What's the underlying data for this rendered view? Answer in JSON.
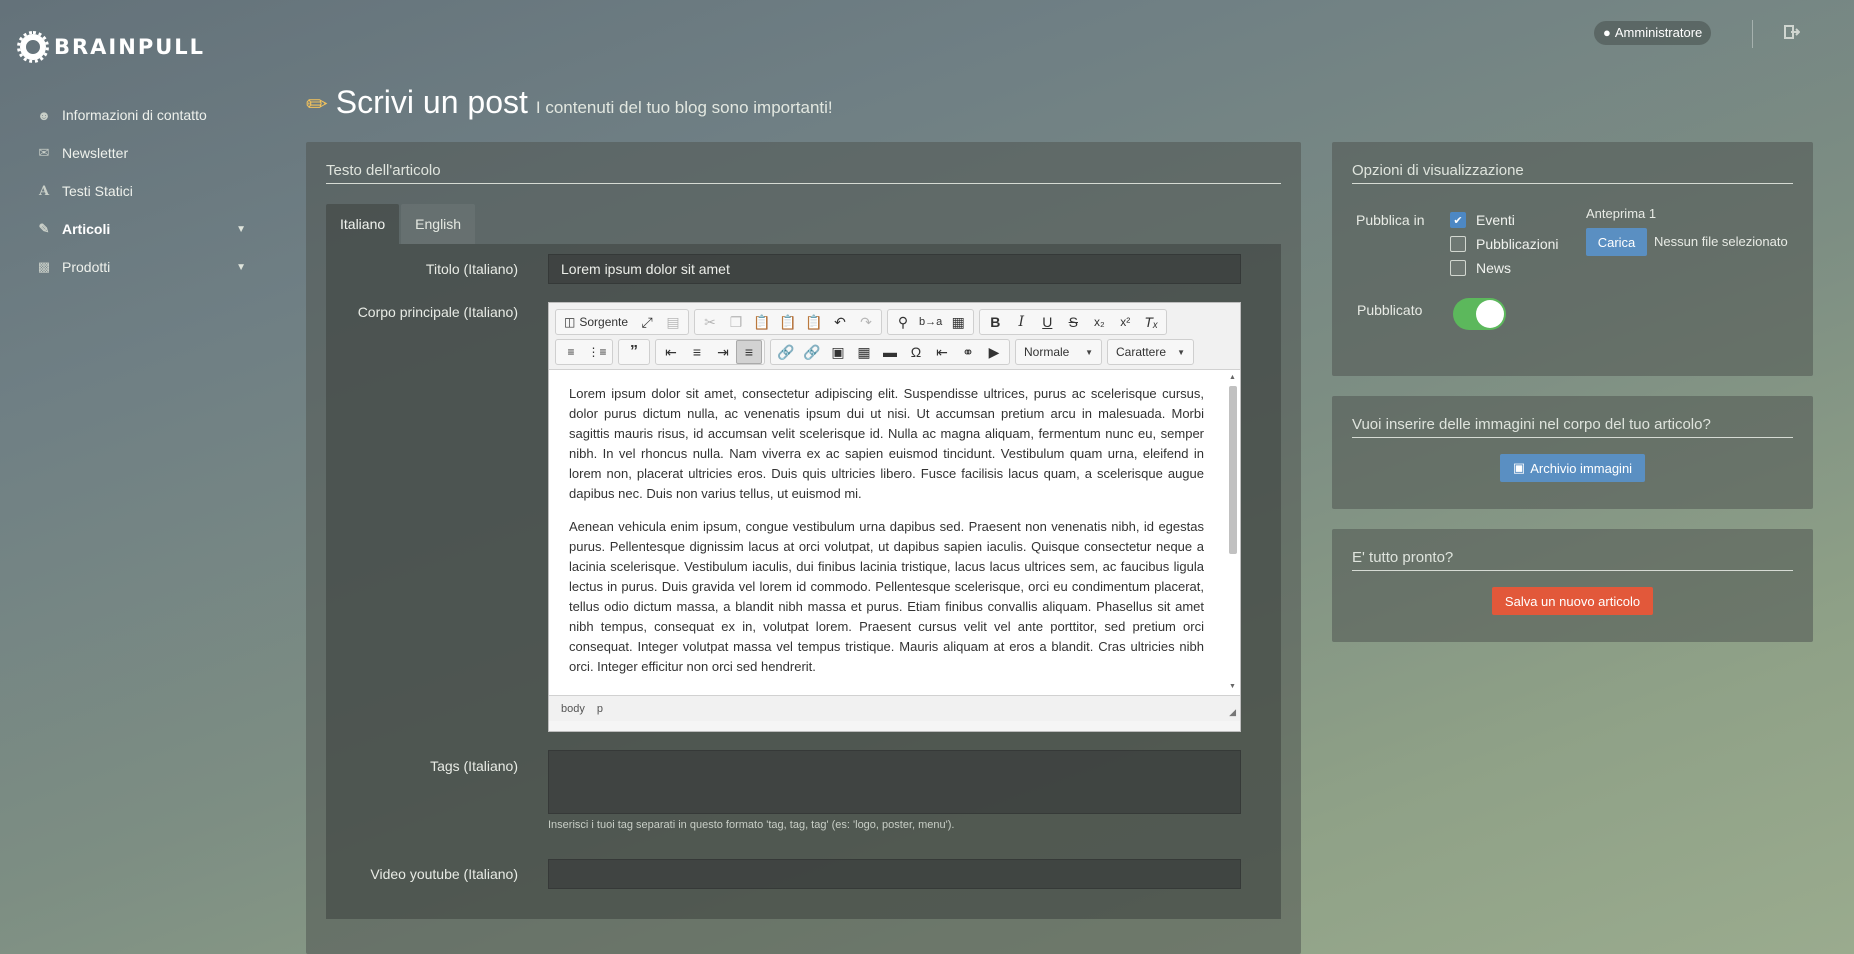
{
  "app": {
    "brand": "BRAINPULL"
  },
  "topbar": {
    "user_label": "Amministratore"
  },
  "sidebar": {
    "items": [
      {
        "label": "Informazioni di contatto",
        "icon": "users-icon"
      },
      {
        "label": "Newsletter",
        "icon": "envelope-icon"
      },
      {
        "label": "Testi Statici",
        "icon": "font-icon"
      },
      {
        "label": "Articoli",
        "icon": "pencil-icon",
        "active": true
      },
      {
        "label": "Prodotti",
        "icon": "briefcase-icon"
      }
    ]
  },
  "header": {
    "title": "Scrivi un post",
    "subtitle": "I contenuti del tuo blog sono importanti!"
  },
  "article": {
    "section_title": "Testo dell'articolo",
    "tabs": [
      {
        "label": "Italiano"
      },
      {
        "label": "English"
      }
    ],
    "title_label": "Titolo (Italiano)",
    "title_value": "Lorem ipsum dolor sit amet",
    "body_label": "Corpo principale (Italiano)",
    "tags_label": "Tags (Italiano)",
    "tags_value": "",
    "tags_help": "Inserisci i tuoi tag separati in questo formato 'tag, tag, tag' (es: 'logo, poster, menu').",
    "video_label": "Video youtube (Italiano)",
    "video_value": ""
  },
  "editor": {
    "source_label": "Sorgente",
    "format_select": "Normale",
    "font_select": "Carattere",
    "paragraphs": [
      "Lorem ipsum dolor sit amet, consectetur adipiscing elit. Suspendisse ultrices, purus ac scelerisque cursus, dolor purus dictum nulla, ac venenatis ipsum dui ut nisi. Ut accumsan pretium arcu in malesuada. Morbi sagittis mauris risus, id accumsan velit scelerisque id. Nulla ac magna aliquam, fermentum nunc eu, semper nibh. In vel rhoncus nulla. Nam viverra ex ac sapien euismod tincidunt. Vestibulum quam urna, eleifend in lorem non, placerat ultricies eros. Duis quis ultricies libero. Fusce facilisis lacus quam, a scelerisque augue dapibus nec. Duis non varius tellus, ut euismod mi.",
      "Aenean vehicula enim ipsum, congue vestibulum urna dapibus sed. Praesent non venenatis nibh, id egestas purus. Pellentesque dignissim lacus at orci volutpat, ut dapibus sapien iaculis. Quisque consectetur neque a lacinia scelerisque. Vestibulum iaculis, dui finibus lacinia tristique, lacus lacus ultrices sem, ac faucibus ligula lectus in purus. Duis gravida vel lorem id commodo. Pellentesque scelerisque, orci eu condimentum placerat, tellus odio dictum massa, a blandit nibh massa et purus. Etiam finibus convallis aliquam. Phasellus sit amet nibh tempus, consequat ex in, volutpat lorem. Praesent cursus velit vel ante porttitor, sed pretium orci consequat. Integer volutpat massa vel tempus tristique. Mauris aliquam at eros a blandit. Cras ultricies nibh orci. Integer efficitur non orci sed hendrerit."
    ],
    "path": [
      "body",
      "p"
    ]
  },
  "options": {
    "title": "Opzioni di visualizzazione",
    "publish_in_label": "Pubblica in",
    "checkboxes": [
      {
        "label": "Eventi",
        "checked": true
      },
      {
        "label": "Pubblicazioni",
        "checked": false
      },
      {
        "label": "News",
        "checked": false
      }
    ],
    "preview_label": "Anteprima 1",
    "upload_button": "Carica",
    "no_file_label": "Nessun file selezionato",
    "published_label": "Pubblicato",
    "published_on": true
  },
  "images": {
    "title": "Vuoi inserire delle immagini nel corpo del tuo articolo?",
    "button": "Archivio immagini"
  },
  "ready": {
    "title": "E' tutto pronto?",
    "button": "Salva un nuovo articolo"
  },
  "colors": {
    "primary": "#5a8fc2",
    "danger": "#e2583a",
    "toggle_on": "#5cb85c"
  }
}
